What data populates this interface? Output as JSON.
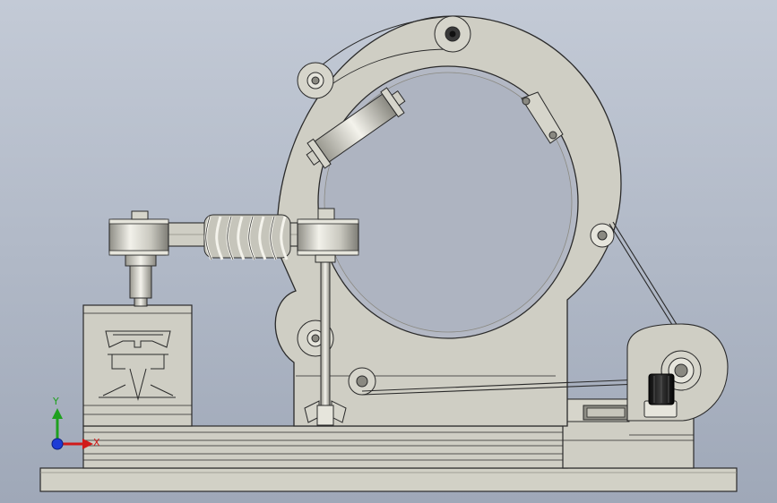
{
  "viewport": {
    "background_top": "#c3cad6",
    "background_bottom": "#9fa8b8",
    "part_fill": "#cfcec4",
    "part_fill_dark": "#b9b8ad",
    "outline": "#2a2a2a"
  },
  "triad": {
    "y_label": "Y",
    "x_label": "X",
    "y_color": "#1ea01e",
    "x_color": "#d11a1a",
    "z_color": "#1e3cd6"
  }
}
